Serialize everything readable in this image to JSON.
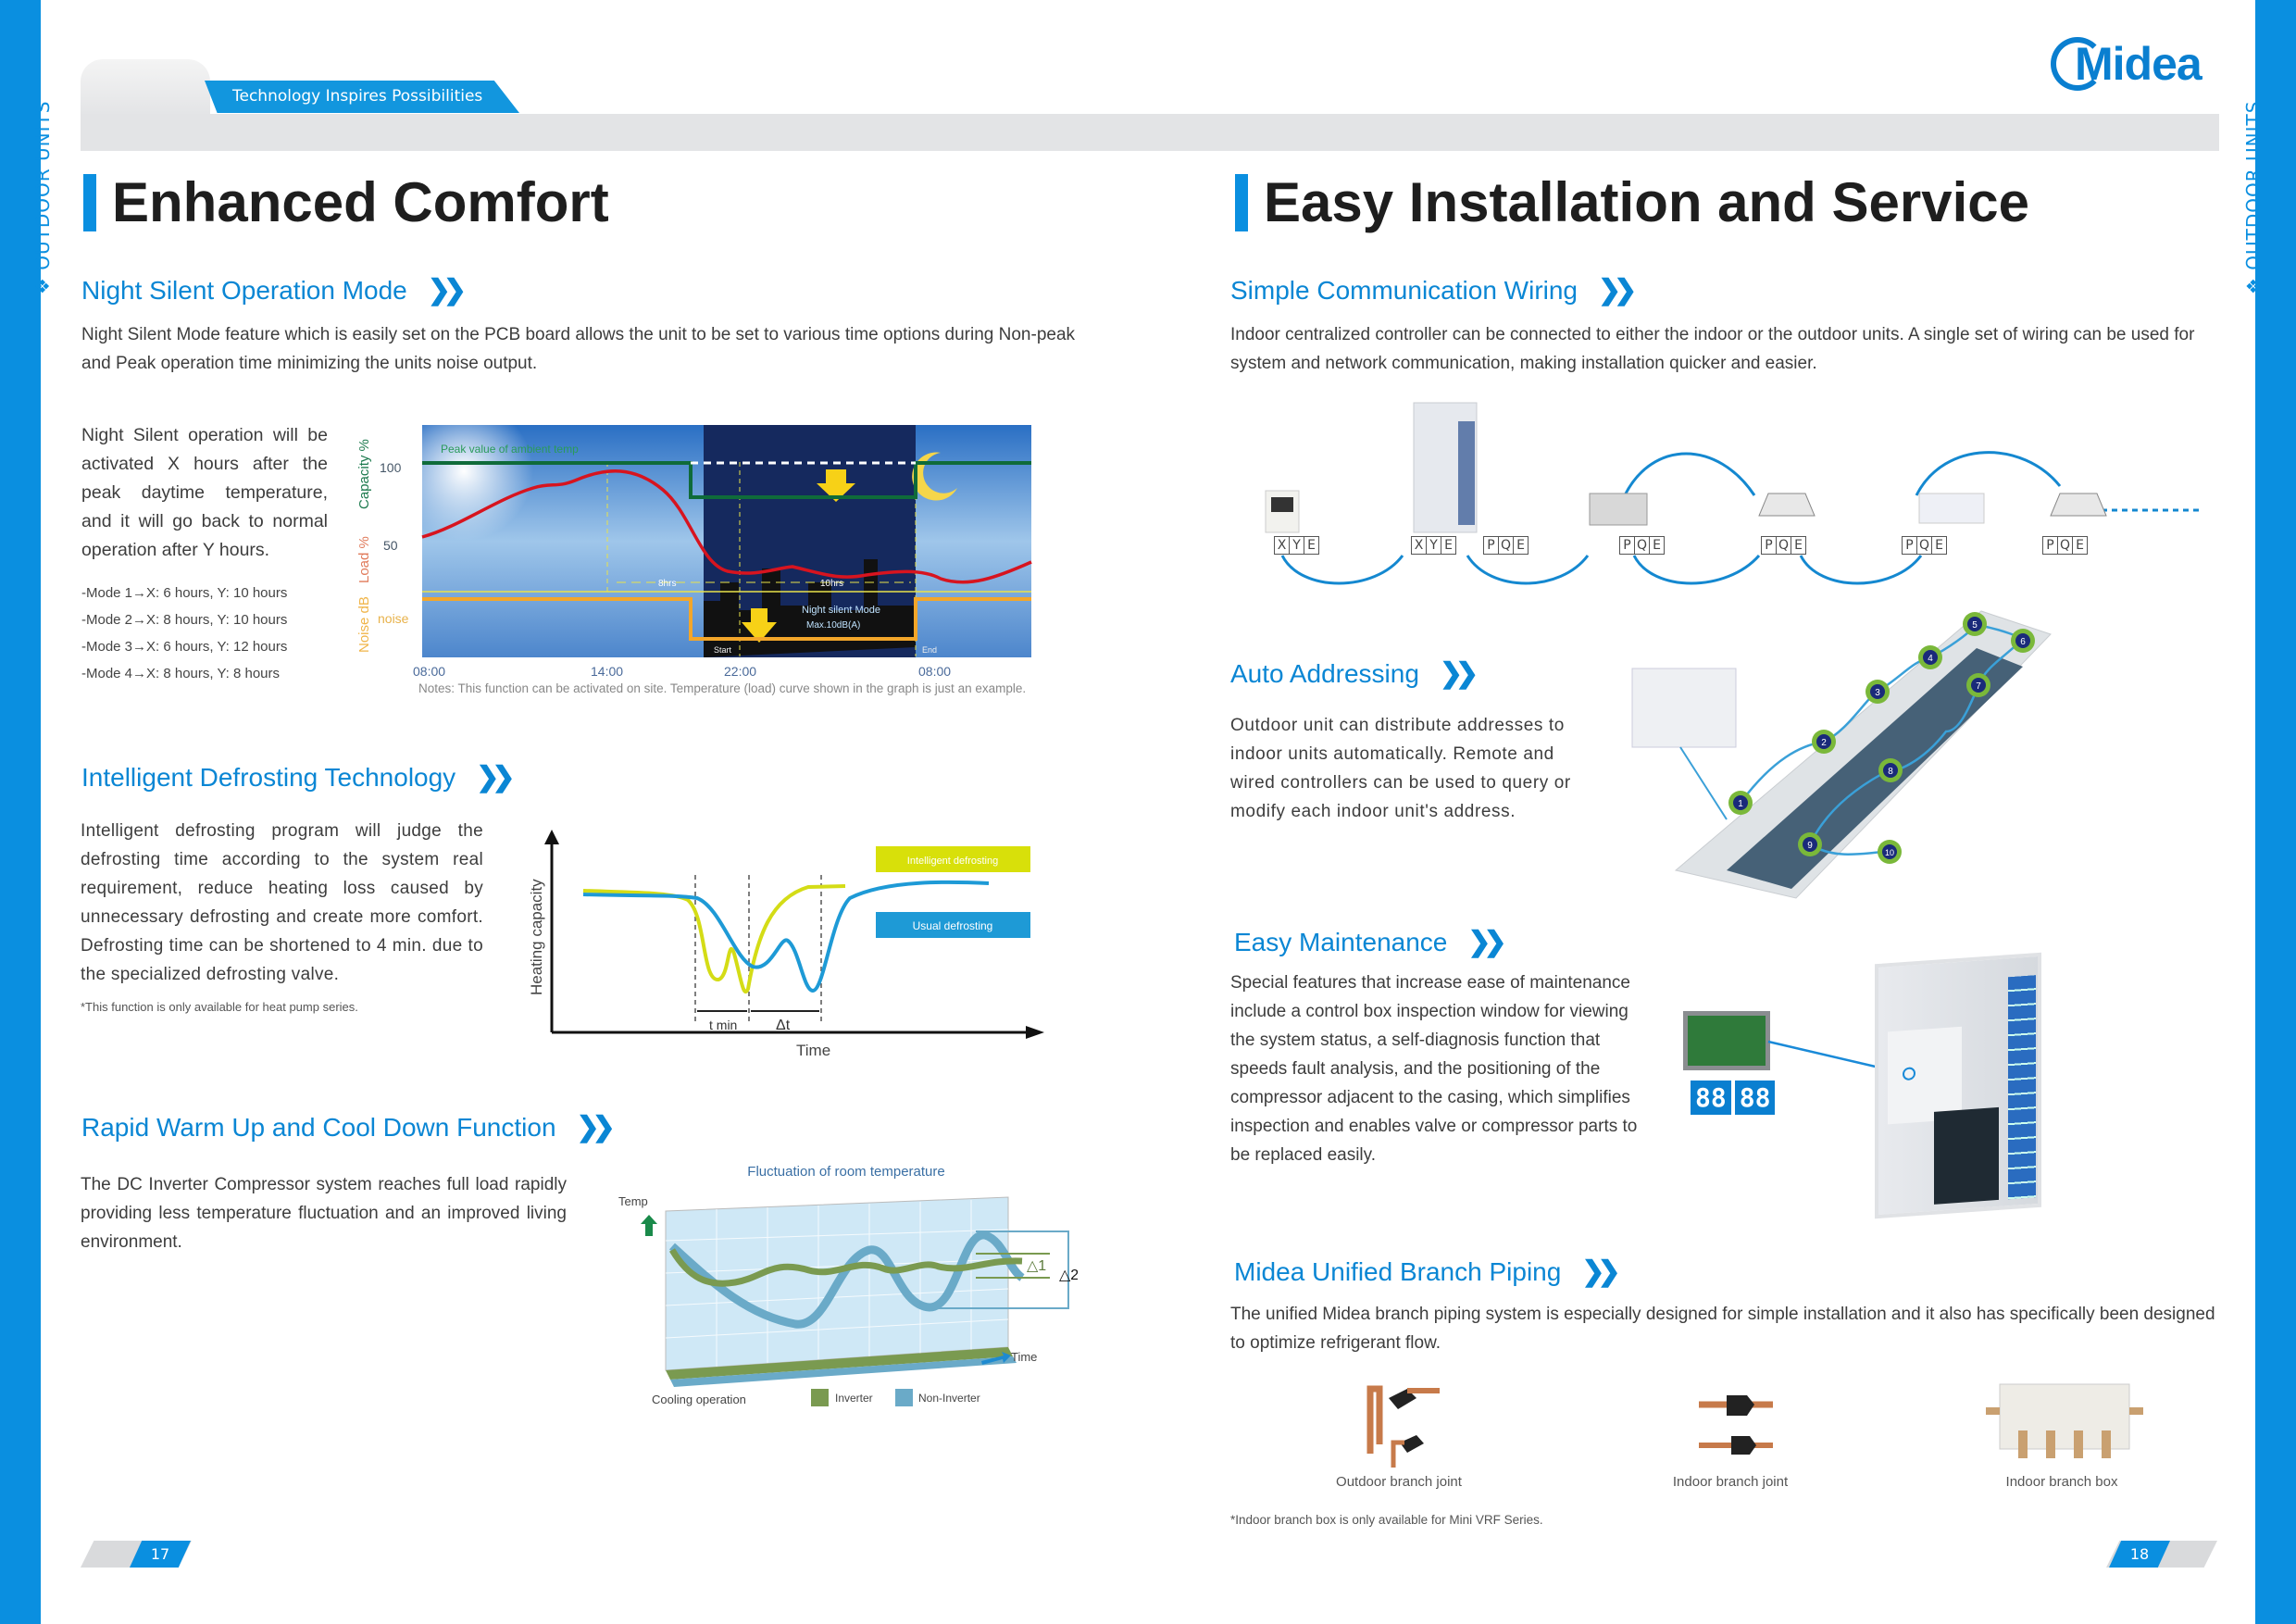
{
  "banner": {
    "tagline": "Technology Inspires Possibilities",
    "logo": "Midea"
  },
  "side": {
    "left": "OUTDOOR UNITS",
    "right": "OUTDOOR UNITS"
  },
  "left": {
    "title": "Enhanced Comfort",
    "night": {
      "heading": "Night Silent Operation Mode",
      "intro": "Night Silent Mode feature which is easily set on the PCB board allows the unit to be set to various time options during Non-peak and Peak operation time minimizing the units noise output.",
      "desc": "Night Silent operation will be activated X hours after the peak daytime temperature, and it will go back to normal operation after Y hours.",
      "modes": [
        "-Mode 1→X: 6 hours, Y: 10 hours",
        "-Mode 2→X: 8 hours, Y: 10 hours",
        "-Mode 3→X: 6 hours, Y: 12 hours",
        "-Mode 4→X: 8 hours, Y: 8 hours"
      ],
      "graph": {
        "capacity_label": "Capacity %",
        "load_label": "Load %",
        "noise_label": "Noise dB",
        "tick_100": "100",
        "tick_50": "50",
        "tick_noise": "noise",
        "peak_label": "Peak value of ambient temp",
        "x_ticks": [
          "08:00",
          "14:00",
          "22:00",
          "08:00"
        ],
        "hrs_a": "8hrs",
        "hrs_b": "10hrs",
        "mode_label": "Night silent Mode",
        "max_label": "Max.10dB(A)",
        "start": "Start",
        "end": "End",
        "colors": {
          "capacity": "#0f6b3a",
          "load": "#d7141f",
          "noise": "#f3a62a",
          "night": "#15295e"
        }
      },
      "notes": "Notes: This function can be activated on site. Temperature (load) curve shown in the graph is just an example."
    },
    "defrost": {
      "heading": "Intelligent Defrosting Technology",
      "body": "Intelligent defrosting program will judge the defrosting time according to the system real requirement, reduce heating loss caused by unnecessary defrosting and create more comfort. Defrosting time can be shortened to 4 min. due to the specialized defrosting valve.",
      "footnote": "*This function is only available for heat pump series.",
      "graph": {
        "y_label": "Heating capacity",
        "x_label": "Time",
        "legend_a": "Intelligent defrosting",
        "legend_b": "Usual defrosting",
        "tmin": "t min",
        "dt": "Δt",
        "colors": {
          "intelligent": "#d4dc16",
          "usual": "#1e9ad6"
        }
      }
    },
    "rapid": {
      "heading": "Rapid Warm Up and Cool Down Function",
      "body": "The DC Inverter Compressor system reaches full load rapidly providing less temperature fluctuation and an improved living environment.",
      "graph": {
        "title": "Fluctuation of room temperature",
        "y_label": "Temp",
        "x_label": "Time",
        "d1": "△1",
        "d2": "△2",
        "caption": "Cooling operation",
        "legend_a": "Inverter",
        "legend_b": "Non-Inverter",
        "colors": {
          "inverter": "#7a9a50",
          "non_inverter": "#6aaac8"
        }
      }
    },
    "page": "17"
  },
  "right": {
    "title": "Easy Installation and Service",
    "wiring": {
      "heading": "Simple Communication Wiring",
      "body": "Indoor centralized controller can be connected to either the indoor or the outdoor units.  A single set of wiring can be used for system and network communication, making installation quicker and easier.",
      "terminals": [
        [
          "X",
          "Y",
          "E"
        ],
        [
          "X",
          "Y",
          "E"
        ],
        [
          "P",
          "Q",
          "E"
        ],
        [
          "P",
          "Q",
          "E"
        ],
        [
          "P",
          "Q",
          "E"
        ],
        [
          "P",
          "Q",
          "E"
        ],
        [
          "P",
          "Q",
          "E"
        ]
      ]
    },
    "addressing": {
      "heading": "Auto Addressing",
      "body": "Outdoor unit can distribute addresses to indoor units automatically. Remote and wired controllers can be used to query or modify each indoor unit's address.",
      "units": [
        "1",
        "2",
        "3",
        "4",
        "5",
        "6",
        "7",
        "8",
        "9",
        "10"
      ]
    },
    "maintenance": {
      "heading": "Easy Maintenance",
      "body": "Special features that increase ease of maintenance include a control box inspection window for viewing the system status, a self-diagnosis function that speeds fault analysis, and the positioning of the compressor adjacent to the casing, which simplifies inspection and enables valve or compressor parts to be replaced easily.",
      "display": [
        "88",
        "88"
      ]
    },
    "branch": {
      "heading": "Midea Unified Branch Piping",
      "body": "The unified Midea branch piping system is especially designed for simple installation and it also has specifically been designed to optimize refrigerant flow.",
      "items": [
        "Outdoor branch joint",
        "Indoor branch joint",
        "Indoor branch box"
      ],
      "footnote": "*Indoor branch box is only available for Mini VRF Series."
    },
    "page": "18"
  },
  "colors": {
    "accent": "#0a8fe0",
    "heading": "#0a86d4",
    "title": "#1e1e1e"
  }
}
